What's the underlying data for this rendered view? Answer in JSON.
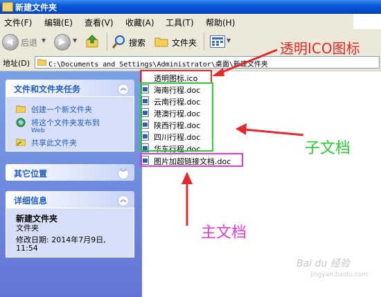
{
  "window": {
    "title": "新建文件夹"
  },
  "menu": [
    "文件(F)",
    "编辑(E)",
    "查看(V)",
    "收藏(A)",
    "工具(T)",
    "帮助(H)"
  ],
  "toolbar": {
    "back": "后退",
    "search": "搜索",
    "folders": "文件夹"
  },
  "address": {
    "label": "地址(D)",
    "path": "C:\\Documents and Settings\\Administrator\\桌面\\新建文件夹"
  },
  "panels": {
    "tasks": {
      "title": "文件和文件夹任务",
      "items": [
        "创建一个新文件夹",
        "将这个文件夹发布到",
        "Web",
        "共享此文件夹"
      ]
    },
    "places": {
      "title": "其它位置"
    },
    "details": {
      "title": "详细信息",
      "name": "新建文件夹",
      "type": "文件夹",
      "modified_line1": "修改日期: 2014年7月9日,",
      "modified_line2": "11:54"
    }
  },
  "files": {
    "ico": "透明图标.ico",
    "children": [
      "海南行程.doc",
      "云南行程.doc",
      "港澳行程.doc",
      "陕西行程.doc",
      "四川行程.doc",
      "华东行程.doc"
    ],
    "main": "图片加超链接文档.doc"
  },
  "annotations": {
    "ico_label": "透明ICO图标",
    "child_label": "子文档",
    "main_label": "主文档"
  },
  "colors": {
    "red": "#e8262b",
    "green": "#26d02e",
    "magenta": "#e43ad9"
  },
  "watermark": {
    "brand": "Bai du 经验",
    "url": "jingyan.baidu.com"
  }
}
